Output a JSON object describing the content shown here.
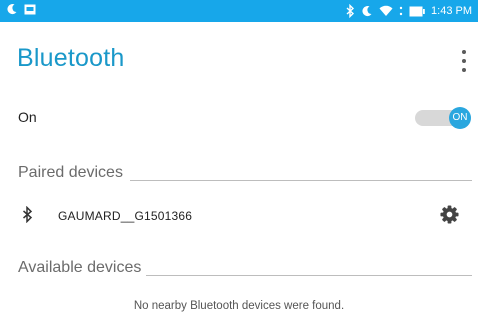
{
  "status_bar": {
    "time": "1:43 PM",
    "left_icons": [
      "moon-icon",
      "message-icon"
    ],
    "right_icons": [
      "bluetooth-icon",
      "moon-icon",
      "wifi-icon",
      "battery-icon"
    ],
    "color": "#17a7ea"
  },
  "header": {
    "title": "Bluetooth",
    "menu_icon": "overflow-menu-icon"
  },
  "bluetooth_toggle": {
    "label": "On",
    "state_label": "ON",
    "enabled": true
  },
  "paired": {
    "title": "Paired devices",
    "devices": [
      {
        "name": "GAUMARD__G1501366",
        "icon": "bluetooth-icon",
        "settings_icon": "gear-icon"
      }
    ]
  },
  "available": {
    "title": "Available devices",
    "empty_message": "No nearby Bluetooth devices were found."
  }
}
